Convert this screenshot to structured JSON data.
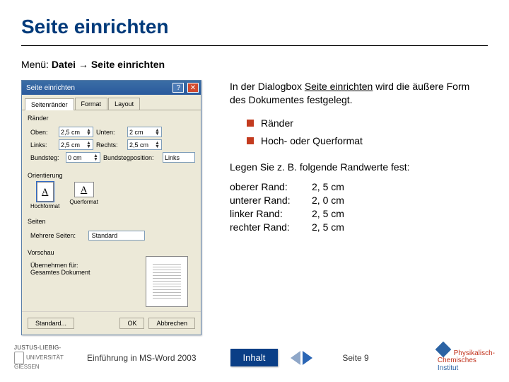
{
  "title": "Seite einrichten",
  "menu": {
    "prefix": "Menü: ",
    "path1": "Datei",
    "arrow": " → ",
    "path2": "Seite einrichten"
  },
  "dialog": {
    "title": "Seite einrichten",
    "tabs": {
      "margins": "Seitenränder",
      "format": "Format",
      "layout": "Layout"
    },
    "section_raender": "Ränder",
    "fields": {
      "oben_l": "Oben:",
      "oben_v": "2,5 cm",
      "unten_l": "Unten:",
      "unten_v": "2 cm",
      "links_l": "Links:",
      "links_v": "2,5 cm",
      "rechts_l": "Rechts:",
      "rechts_v": "2,5 cm",
      "bund_l": "Bundsteg:",
      "bund_v": "0 cm",
      "bundpos_l": "Bundstegposition:",
      "bundpos_v": "Links"
    },
    "section_orient": "Orientierung",
    "orient_portrait": "Hochformat",
    "orient_landscape": "Querformat",
    "section_seiten": "Seiten",
    "seiten_label": "Mehrere Seiten:",
    "seiten_value": "Standard",
    "section_vorschau": "Vorschau",
    "uebernehmen_label": "Übernehmen für:",
    "uebernehmen_value": "Gesamtes Dokument",
    "btn_standard": "Standard...",
    "btn_ok": "OK",
    "btn_cancel": "Abbrechen"
  },
  "desc": {
    "pre": "In der Dialogbox ",
    "u": "Seite einrichten",
    "post": " wird die äußere Form des Dokumentes festgelegt."
  },
  "bullets": {
    "b1": "Ränder",
    "b2": "Hoch- oder Querformat"
  },
  "legen": "Legen Sie z. B. folgende Randwerte fest:",
  "vals": {
    "r1k": "oberer Rand:",
    "r1v": "2, 5 cm",
    "r2k": "unterer Rand:",
    "r2v": "2, 0 cm",
    "r3k": "linker Rand:",
    "r3v": "2, 5 cm",
    "r4k": "rechter Rand:",
    "r4v": "2, 5 cm"
  },
  "footer": {
    "uni_top": "JUSTUS-LIEBIG-",
    "uni_bot": "UNIVERSITÄT GIESSEN",
    "lecture": "Einführung in MS-Word 2003",
    "toc": "Inhalt",
    "page": "Seite 9",
    "inst1": "Physikalisch-",
    "inst2": "Chemisches",
    "inst3": "Institut"
  }
}
